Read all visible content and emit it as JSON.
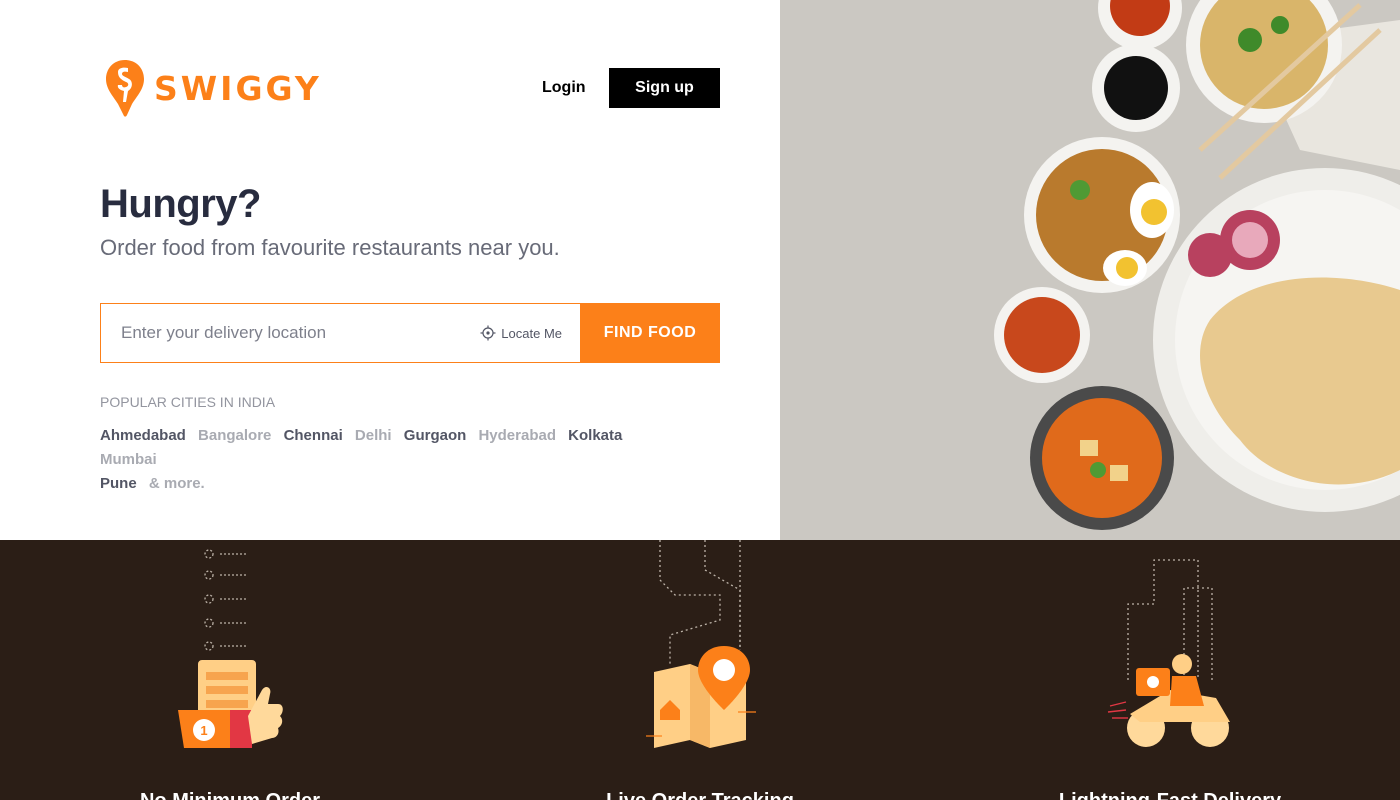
{
  "brand": {
    "name": "SWIGGY",
    "color": "#fc8019"
  },
  "header": {
    "login_label": "Login",
    "signup_label": "Sign up"
  },
  "hero": {
    "headline": "Hungry?",
    "subheadline": "Order food from favourite restaurants near you.",
    "image_icon": "food-platter-photo"
  },
  "search": {
    "placeholder": "Enter your delivery location",
    "value": "",
    "locate_label": "Locate Me",
    "locate_icon": "crosshair-icon",
    "button_label": "FIND FOOD"
  },
  "popular": {
    "title": "POPULAR CITIES IN INDIA",
    "cities": [
      {
        "name": "Ahmedabad",
        "tone": "dark"
      },
      {
        "name": "Bangalore",
        "tone": "light"
      },
      {
        "name": "Chennai",
        "tone": "dark"
      },
      {
        "name": "Delhi",
        "tone": "light"
      },
      {
        "name": "Gurgaon",
        "tone": "dark"
      },
      {
        "name": "Hyderabad",
        "tone": "light"
      },
      {
        "name": "Kolkata",
        "tone": "dark"
      },
      {
        "name": "Mumbai",
        "tone": "light"
      },
      {
        "name": "Pune",
        "tone": "dark"
      },
      {
        "name": "& more.",
        "tone": "light"
      }
    ]
  },
  "features": [
    {
      "title": "No Minimum Order",
      "icon": "thumbs-up-menu-icon"
    },
    {
      "title": "Live Order Tracking",
      "icon": "map-location-pin-icon"
    },
    {
      "title": "Lightning-Fast Delivery",
      "icon": "delivery-scooter-icon"
    }
  ],
  "colors": {
    "accent": "#fc8019",
    "dark_band": "#2b1e16",
    "text_dark": "#282c3f",
    "text_muted": "#686b78"
  }
}
